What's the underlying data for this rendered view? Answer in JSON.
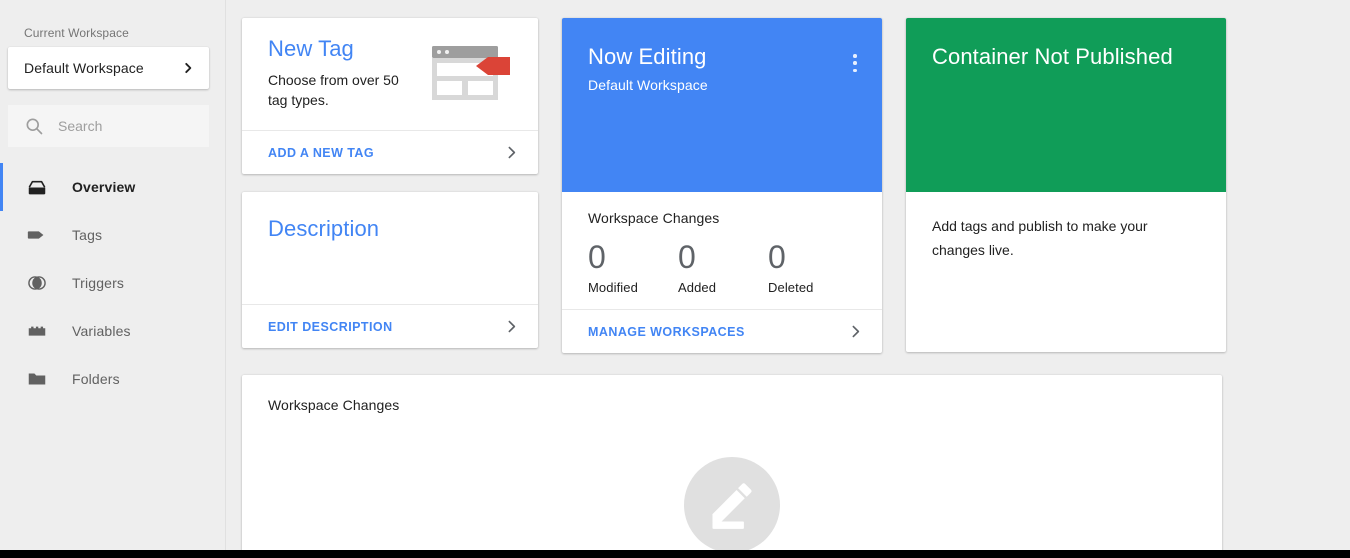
{
  "sidebar": {
    "workspace_label": "Current Workspace",
    "workspace_name": "Default Workspace",
    "search_placeholder": "Search",
    "search_value": "",
    "items": [
      {
        "label": "Overview",
        "icon": "container-icon",
        "active": true
      },
      {
        "label": "Tags",
        "icon": "tag-icon",
        "active": false
      },
      {
        "label": "Triggers",
        "icon": "trigger-icon",
        "active": false
      },
      {
        "label": "Variables",
        "icon": "variable-icon",
        "active": false
      },
      {
        "label": "Folders",
        "icon": "folder-icon",
        "active": false
      }
    ]
  },
  "new_tag_card": {
    "title": "New Tag",
    "subtitle": "Choose from over 50 tag types.",
    "action_label": "ADD A NEW TAG"
  },
  "description_card": {
    "title": "Description",
    "action_label": "EDIT DESCRIPTION"
  },
  "now_editing_card": {
    "title": "Now Editing",
    "subtitle": "Default Workspace",
    "changes_heading": "Workspace Changes",
    "stats": [
      {
        "value": "0",
        "label": "Modified"
      },
      {
        "value": "0",
        "label": "Added"
      },
      {
        "value": "0",
        "label": "Deleted"
      }
    ],
    "action_label": "MANAGE WORKSPACES"
  },
  "published_card": {
    "title": "Container Not Published",
    "body": "Add tags and publish to make your changes live."
  },
  "workspace_changes_panel": {
    "heading": "Workspace Changes",
    "empty_icon": "create-icon"
  },
  "colors": {
    "accent_blue": "#4285F4",
    "status_green": "#109D58",
    "tag_red": "#DB4437",
    "background": "#EEEEEE",
    "card": "#FFFFFF"
  }
}
